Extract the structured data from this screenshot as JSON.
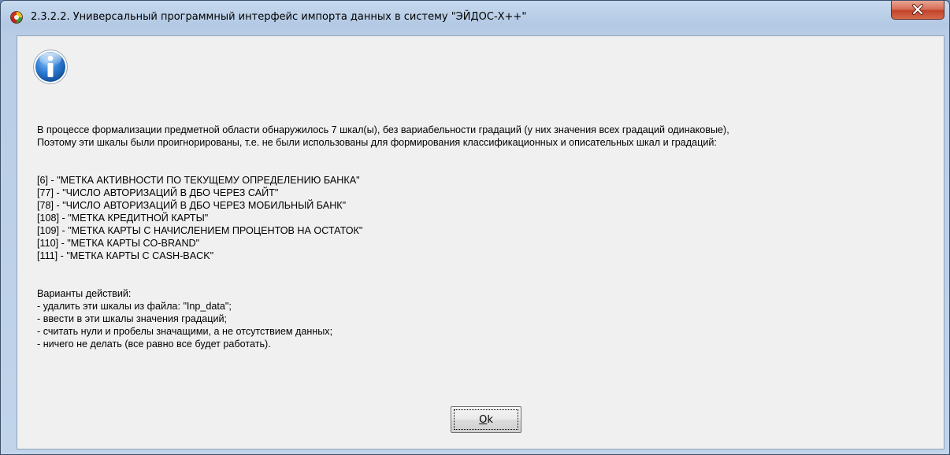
{
  "window": {
    "title": "2.3.2.2. Универсальный программный интерфейс импорта данных в систему \"ЭЙДОС-X++\"",
    "close_icon": "close-x-icon",
    "app_icon": "aidos-app-icon"
  },
  "dialog": {
    "icon": "information-icon",
    "intro_lines": [
      "В процессе формализации предметной области обнаружилось 7 шкал(ы), без вариабельности градаций (у них значения всех градаций одинаковые),",
      "Поэтому эти шкалы были проигнорированы, т.е. не были использованы для формирования классификационных и описательных шкал и градаций:"
    ],
    "scales": [
      "[6] - \"МЕТКА АКТИВНОСТИ ПО ТЕКУЩЕМУ ОПРЕДЕЛЕНИЮ БАНКА\"",
      "[77] - \"ЧИСЛО АВТОРИЗАЦИЙ В ДБО ЧЕРЕЗ САЙТ\"",
      "[78] - \"ЧИСЛО АВТОРИЗАЦИЙ В ДБО ЧЕРЕЗ МОБИЛЬНЫЙ БАНК\"",
      "[108] - \"МЕТКА КРЕДИТНОЙ КАРТЫ\"",
      "[109] - \"МЕТКА КАРТЫ С НАЧИСЛЕНИЕМ ПРОЦЕНТОВ НА ОСТАТОК\"",
      "[110] - \"МЕТКА КАРТЫ CO-BRAND\"",
      "[111] - \"МЕТКА КАРТЫ С CASH-BACK\""
    ],
    "actions_heading": "Варианты действий:",
    "actions": [
      "- удалить эти шкалы из файла: \"Inp_data\";",
      "- ввести в эти шкалы значения градаций;",
      "- считать нули и пробелы значащими, а не отсутствием данных;",
      "- ничего не делать (все равно все будет работать)."
    ],
    "ok_accel": "O",
    "ok_rest": "k"
  }
}
